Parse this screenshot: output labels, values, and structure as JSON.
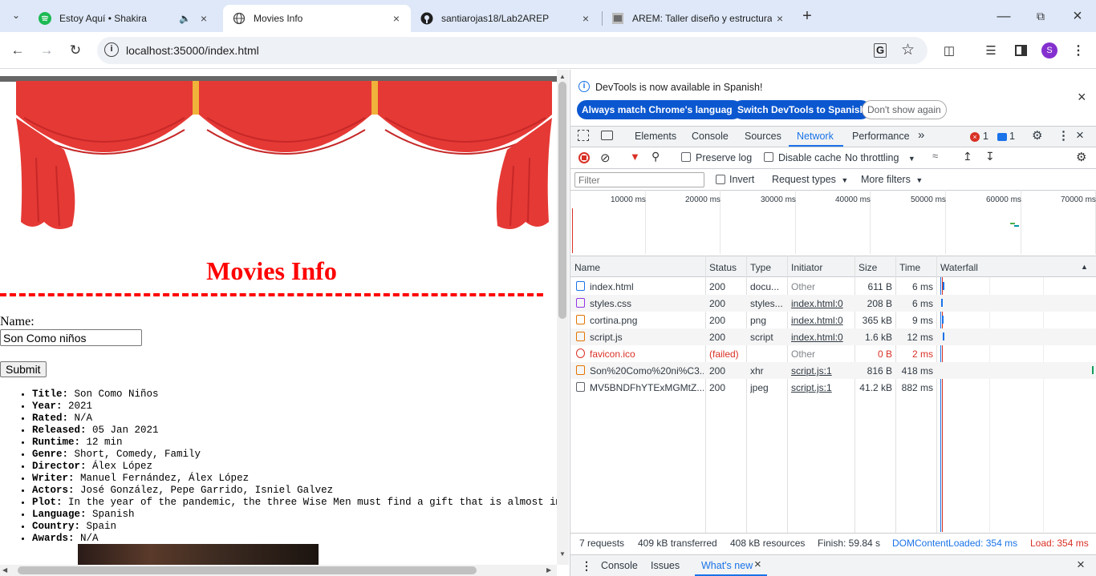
{
  "browser": {
    "tabs": [
      {
        "title": "Estoy Aquí • Shakira",
        "icon": "spotify-icon",
        "audio": true
      },
      {
        "title": "Movies Info",
        "icon": "globe-icon"
      },
      {
        "title": "santiarojas18/Lab2AREP",
        "icon": "github-icon"
      },
      {
        "title": "AREM: Taller diseño y estructura",
        "icon": "document-icon"
      }
    ],
    "url": "localhost:35000/index.html",
    "profile_initial": "S"
  },
  "page": {
    "title": "Movies Info",
    "name_label": "Name:",
    "name_value": "Son Como niños",
    "submit_label": "Submit",
    "movie": [
      {
        "k": "Title:",
        "v": "Son Como Niños"
      },
      {
        "k": "Year:",
        "v": "2021"
      },
      {
        "k": "Rated:",
        "v": "N/A"
      },
      {
        "k": "Released:",
        "v": "05 Jan 2021"
      },
      {
        "k": "Runtime:",
        "v": "12 min"
      },
      {
        "k": "Genre:",
        "v": "Short, Comedy, Family"
      },
      {
        "k": "Director:",
        "v": "Álex López"
      },
      {
        "k": "Writer:",
        "v": "Manuel Fernández, Álex López"
      },
      {
        "k": "Actors:",
        "v": "José González, Pepe Garrido, Isniel Galvez"
      },
      {
        "k": "Plot:",
        "v": "In the year of the pandemic, the three Wise Men must find a gift that is almost impossible"
      },
      {
        "k": "Language:",
        "v": "Spanish"
      },
      {
        "k": "Country:",
        "v": "Spain"
      },
      {
        "k": "Awards:",
        "v": "N/A"
      }
    ]
  },
  "devtools": {
    "banner": "DevTools is now available in Spanish!",
    "btn_match": "Always match Chrome's language",
    "btn_switch": "Switch DevTools to Spanish",
    "btn_dont": "Don't show again",
    "tabs": [
      "Elements",
      "Console",
      "Sources",
      "Network",
      "Performance"
    ],
    "errors": "1",
    "messages": "1",
    "preserve_log": "Preserve log",
    "disable_cache": "Disable cache",
    "throttling": "No throttling",
    "filter_placeholder": "Filter",
    "invert": "Invert",
    "request_types": "Request types",
    "more_filters": "More filters",
    "ruler": [
      "10000 ms",
      "20000 ms",
      "30000 ms",
      "40000 ms",
      "50000 ms",
      "60000 ms",
      "70000 ms"
    ],
    "columns": [
      "Name",
      "Status",
      "Type",
      "Initiator",
      "Size",
      "Time",
      "Waterfall"
    ],
    "rows": [
      {
        "name": "index.html",
        "status": "200",
        "type": "docu...",
        "initiator": "Other",
        "size": "611 B",
        "time": "6 ms",
        "icon": "document-icon",
        "color": "#1a73e8"
      },
      {
        "name": "styles.css",
        "status": "200",
        "type": "styles...",
        "initiator": "index.html:0",
        "size": "208 B",
        "time": "6 ms",
        "icon": "stylesheet-icon",
        "color": "#9334e6"
      },
      {
        "name": "cortina.png",
        "status": "200",
        "type": "png",
        "initiator": "index.html:0",
        "size": "365 kB",
        "time": "9 ms",
        "icon": "image-icon",
        "color": "#e37400"
      },
      {
        "name": "script.js",
        "status": "200",
        "type": "script",
        "initiator": "index.html:0",
        "size": "1.6 kB",
        "time": "12 ms",
        "icon": "script-icon",
        "color": "#e37400"
      },
      {
        "name": "favicon.ico",
        "status": "(failed)",
        "type": "",
        "initiator": "Other",
        "size": "0 B",
        "time": "2 ms",
        "icon": "error-icon",
        "color": "#d93025",
        "failed": true
      },
      {
        "name": "Son%20Como%20ni%C3...",
        "status": "200",
        "type": "xhr",
        "initiator": "script.js:1",
        "size": "816 B",
        "time": "418 ms",
        "icon": "xhr-icon",
        "color": "#e37400"
      },
      {
        "name": "MV5BNDFhYTExMGMtZ...",
        "status": "200",
        "type": "jpeg",
        "initiator": "script.js:1",
        "size": "41.2 kB",
        "time": "882 ms",
        "icon": "image-icon",
        "color": "#5f6368"
      }
    ],
    "summary": {
      "requests": "7 requests",
      "transferred": "409 kB transferred",
      "resources": "408 kB resources",
      "finish": "Finish: 59.84 s",
      "dcl": "DOMContentLoaded: 354 ms",
      "load": "Load: 354 ms"
    },
    "drawer": [
      "Console",
      "Issues",
      "What's new"
    ]
  }
}
